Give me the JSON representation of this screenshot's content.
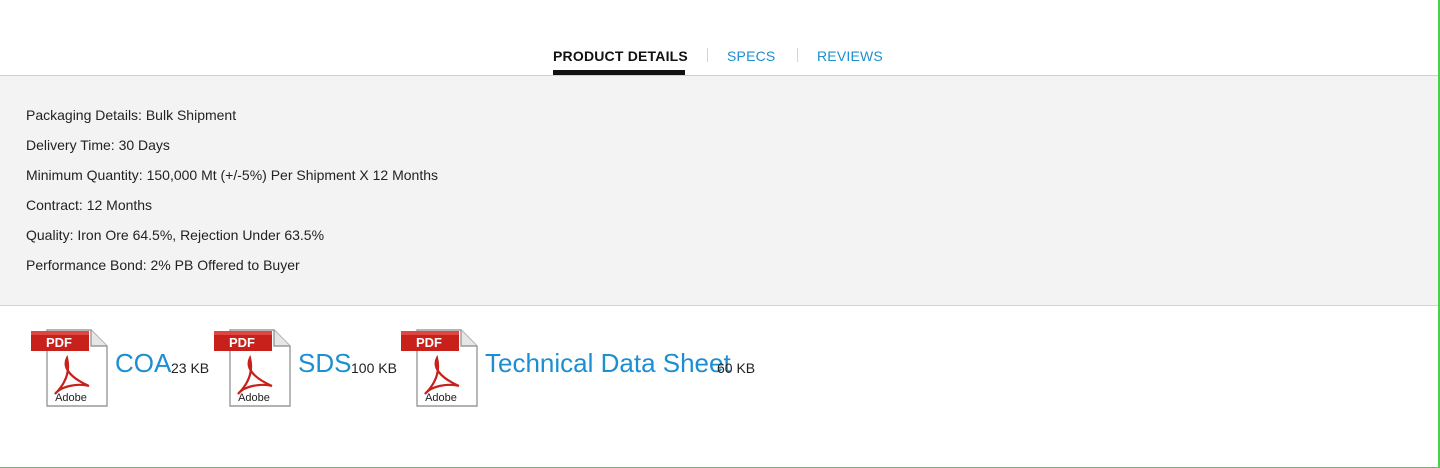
{
  "tabs": {
    "product_details": "PRODUCT DETAILS",
    "specs": "SPECS",
    "reviews": "REVIEWS"
  },
  "details": [
    "Packaging Details: Bulk Shipment",
    "Delivery Time: 30 Days",
    "Minimum Quantity: 150,000 Mt (+/-5%) Per Shipment X 12 Months",
    "Contract: 12 Months",
    "Quality: Iron Ore 64.5%, Rejection Under 63.5%",
    "Performance Bond: 2% PB Offered to Buyer"
  ],
  "icon": {
    "badge": "PDF",
    "brand": "Adobe",
    "name": "pdf-adobe-icon"
  },
  "files": [
    {
      "name": "COA",
      "size": "23 KB"
    },
    {
      "name": "SDS",
      "size": "100 KB"
    },
    {
      "name": "Technical Data Sheet",
      "size": "60 KB"
    }
  ],
  "colors": {
    "link": "#1b8fd2",
    "panel": "#f3f3f3",
    "pdf_red": "#c8201a",
    "edge": "#4cd04c"
  }
}
